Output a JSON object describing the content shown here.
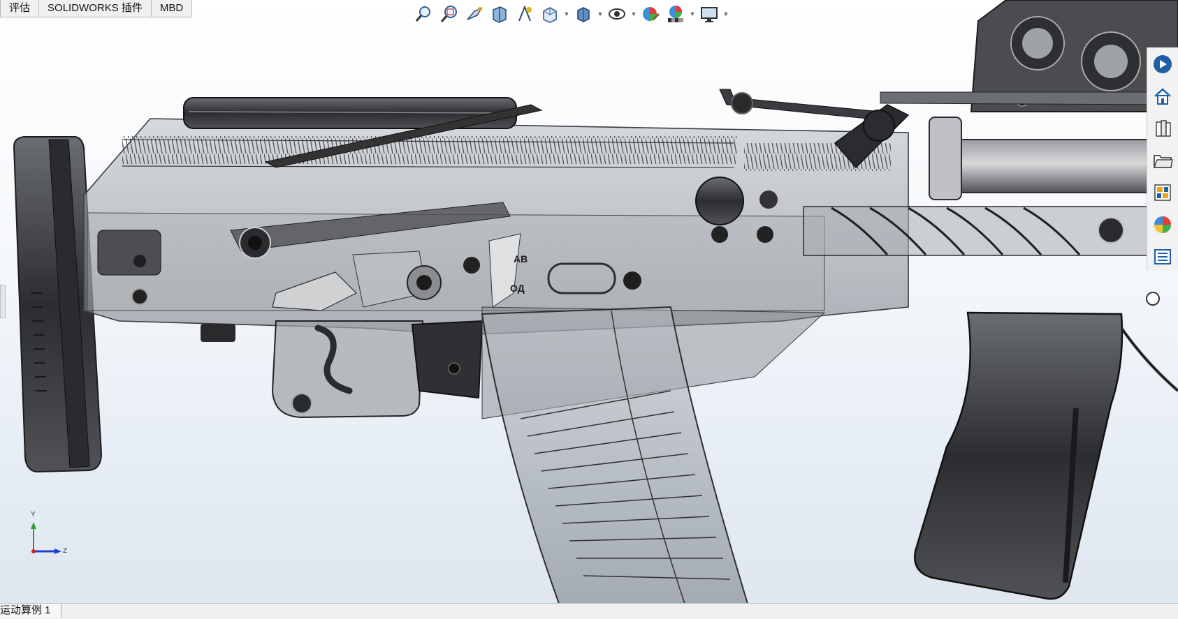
{
  "menu_tabs": [
    {
      "label": "评估"
    },
    {
      "label": "SOLIDWORKS 插件"
    },
    {
      "label": "MBD"
    }
  ],
  "heads_up_toolbar": [
    {
      "icon": "zoom-to-fit-icon"
    },
    {
      "icon": "zoom-to-area-icon"
    },
    {
      "icon": "previous-view-icon"
    },
    {
      "icon": "section-view-icon"
    },
    {
      "icon": "dynamic-annotation-icon"
    },
    {
      "icon": "view-orientation-icon"
    },
    {
      "icon": "display-style-icon"
    },
    {
      "icon": "hide-show-items-icon"
    },
    {
      "icon": "edit-appearance-icon"
    },
    {
      "icon": "apply-scene-icon"
    },
    {
      "icon": "view-settings-icon"
    }
  ],
  "task_pane": [
    {
      "icon": "solidworks-resources-icon"
    },
    {
      "icon": "home-icon"
    },
    {
      "icon": "design-library-icon"
    },
    {
      "icon": "file-explorer-icon"
    },
    {
      "icon": "view-palette-icon"
    },
    {
      "icon": "appearances-scenes-icon"
    },
    {
      "icon": "custom-properties-icon"
    }
  ],
  "triad": {
    "y_label": "Y",
    "z_label": "Z"
  },
  "receiver_markings": {
    "upper": "АВ",
    "lower": "ОД"
  },
  "status_tab": {
    "label": "运动算例 1"
  },
  "colors": {
    "accent_blue": "#1e5fa8",
    "dark_part": "#3a3a3d",
    "glass_part": "#9aa0a6"
  }
}
